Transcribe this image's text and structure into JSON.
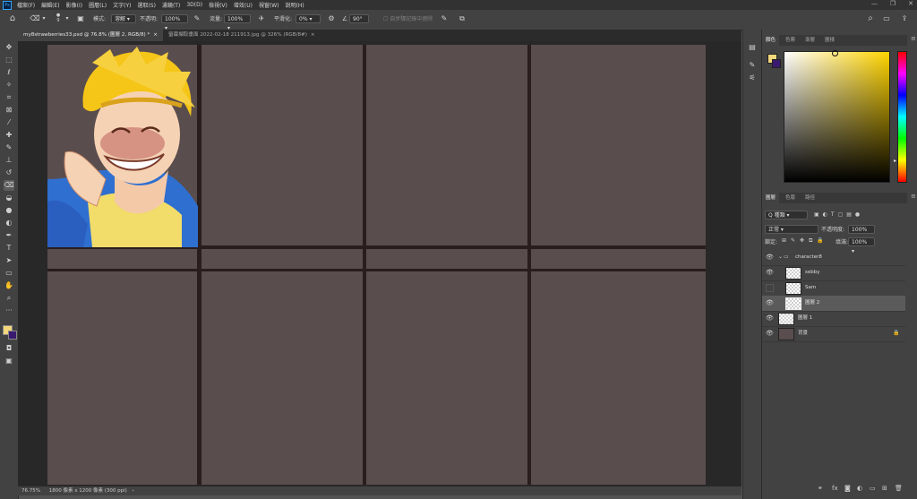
{
  "menubar": {
    "logo": "Ps",
    "items": [
      "檔案(F)",
      "編輯(E)",
      "影像(I)",
      "圖層(L)",
      "文字(Y)",
      "選取(S)",
      "濾鏡(T)",
      "3D(D)",
      "檢視(V)",
      "增效(U)",
      "視窗(W)",
      "說明(H)"
    ],
    "window_controls": [
      "—",
      "❐",
      "✕"
    ]
  },
  "options": {
    "brush_size": "9",
    "mode_label": "模式:",
    "mode_value": "溶解",
    "opacity_label": "不透明:",
    "opacity_value": "100%",
    "flow_label": "流量:",
    "flow_value": "100%",
    "smoothing_label": "平滑化:",
    "smoothing_value": "0%",
    "angle_value": "90°",
    "erase_history_label": "自步驟記錄中擦除"
  },
  "tabs": [
    {
      "label": "my8strawberries33.psd @ 76.8% (圖層 2, RGB/8) *",
      "close": "×"
    },
    {
      "label": "螢幕擷取畫面 2022-02-18 211913.jpg @ 326% (RGB/8#)",
      "close": "×"
    }
  ],
  "status": {
    "zoom": "76.75%",
    "doc_info": "1800 像素 x 1200 像素 (300 ppi)",
    "arrow": "›"
  },
  "color_panel": {
    "tabs": [
      "顏色",
      "色票",
      "漸層",
      "圖樣"
    ],
    "foreground": "#f3d77a",
    "background": "#3a1a6e",
    "hue": "#ffd400"
  },
  "layers_panel": {
    "tabs": [
      "圖層",
      "色版",
      "路徑"
    ],
    "filter_label": "Q 種類",
    "blend_mode": "正常",
    "opacity_label": "不透明度:",
    "opacity_value": "100%",
    "lock_label": "鎖定:",
    "fill_label": "填滿:",
    "fill_value": "100%",
    "layers": [
      {
        "name": "character8",
        "visible": true
      },
      {
        "name": "sebby",
        "visible": true
      },
      {
        "name": "Sam",
        "visible": false
      },
      {
        "name": "圖層 2",
        "visible": true
      },
      {
        "name": "圖層 1",
        "visible": true
      },
      {
        "name": "背景",
        "visible": true
      }
    ],
    "footer_icons": [
      "link-icon",
      "fx-icon",
      "mask-icon",
      "adjust-icon",
      "folder-icon",
      "new-layer-icon",
      "trash-icon"
    ]
  },
  "icons": {
    "eye": "👁",
    "lock": "🔒",
    "search": "⌕",
    "gear": "⚙",
    "home": "⌂"
  }
}
